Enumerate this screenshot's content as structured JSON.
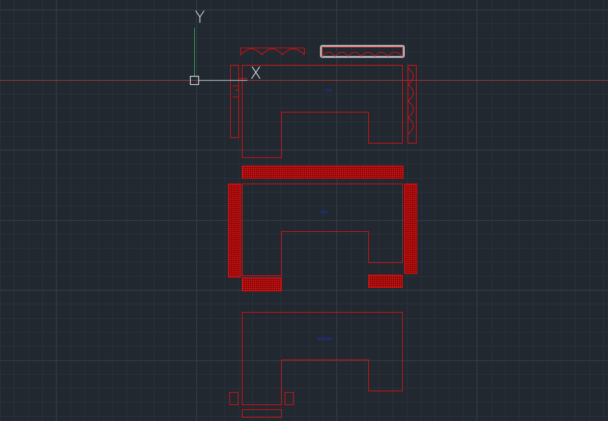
{
  "canvas": {
    "background": "#212830",
    "minor_grid_color": "#2a313b",
    "major_grid_color": "#363d48"
  },
  "ucs_icon": {
    "x_label": "X",
    "y_label": "Y",
    "icon_color": "#dde3e8",
    "x_axis_color": "#b0b6bc",
    "y_axis_color": "#2eb64a"
  },
  "crosshair": {
    "color": "#b13030"
  },
  "geometry": {
    "outline_color": "#e01010",
    "hatch_color": "#cc0000",
    "selection_color": "#c0c4ca"
  },
  "drawing_labels": {
    "color": "#1a33e6",
    "top_view": "TOP",
    "middle_view": "Plan",
    "bottom_view": "SECTION"
  }
}
